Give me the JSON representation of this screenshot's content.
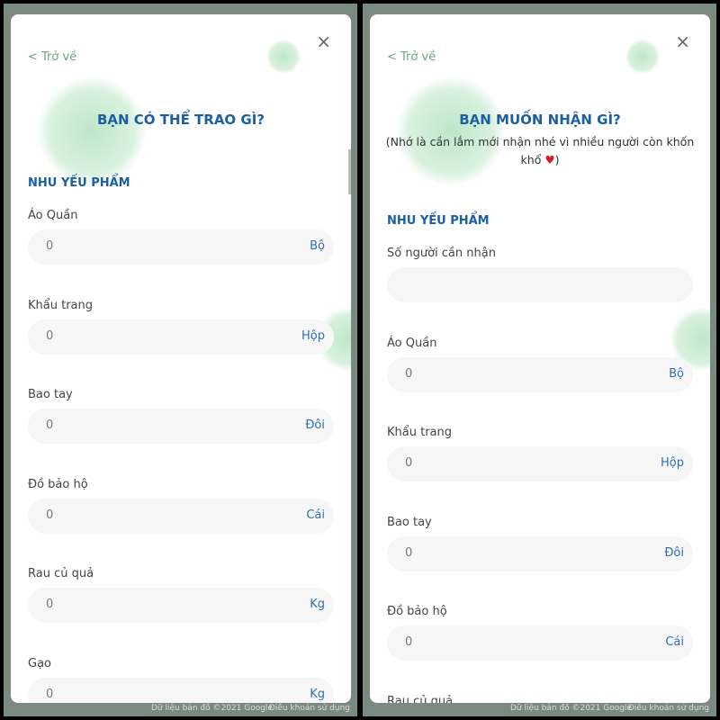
{
  "map_footer": {
    "data": "Dữ liệu bản đồ ©2021 Google",
    "terms": "Điều khoản sử dụng"
  },
  "left": {
    "back": "< Trở về",
    "close": "×",
    "title": "BẠN CÓ THỂ TRAO GÌ?",
    "section": "NHU YẾU PHẨM",
    "rows": [
      {
        "label": "Áo Quần",
        "value": "0",
        "unit": "Bộ"
      },
      {
        "label": "Khẩu trang",
        "value": "0",
        "unit": "Hộp"
      },
      {
        "label": "Bao tay",
        "value": "0",
        "unit": "Đôi"
      },
      {
        "label": "Đồ bảo hộ",
        "value": "0",
        "unit": "Cái"
      },
      {
        "label": "Rau củ quả",
        "value": "0",
        "unit": "Kg"
      },
      {
        "label": "Gạo",
        "value": "0",
        "unit": "Kg"
      }
    ]
  },
  "right": {
    "back": "< Trở về",
    "close": "×",
    "title": "BẠN MUỐN NHẬN GÌ?",
    "subtitle": "(Nhớ là cần lắm mới nhận nhé vì nhiều người còn khốn khổ",
    "heart": "♥",
    "subtitle_end": ")",
    "section": "NHU YẾU PHẨM",
    "rows": [
      {
        "label": "Số người cần nhận",
        "value": "",
        "unit": ""
      },
      {
        "label": "Áo Quần",
        "value": "0",
        "unit": "Bộ"
      },
      {
        "label": "Khẩu trang",
        "value": "0",
        "unit": "Hộp"
      },
      {
        "label": "Bao tay",
        "value": "0",
        "unit": "Đôi"
      },
      {
        "label": "Đồ bảo hộ",
        "value": "0",
        "unit": "Cái"
      },
      {
        "label": "Rau củ quả",
        "value": "",
        "unit": ""
      }
    ]
  }
}
